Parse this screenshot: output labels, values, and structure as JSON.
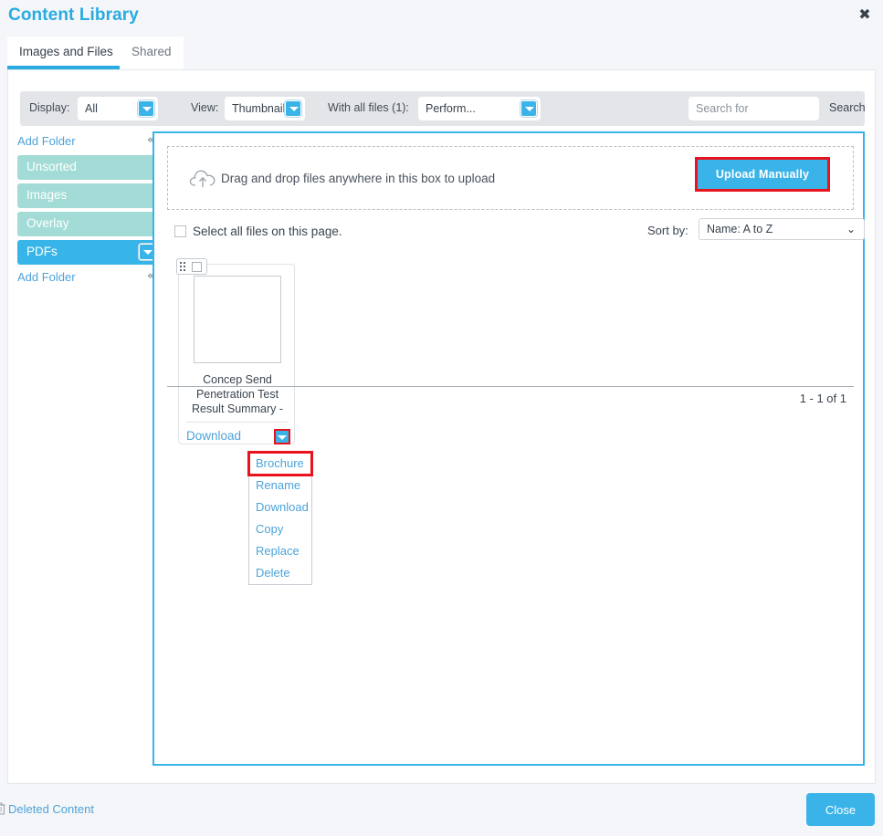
{
  "window": {
    "title": "Content Library",
    "close_icon": "close-x-icon"
  },
  "tabs": [
    {
      "label": "Images and Files",
      "active": true
    },
    {
      "label": "Shared",
      "active": false
    }
  ],
  "toolbar": {
    "display_label": "Display:",
    "display_value": "All",
    "view_label": "View:",
    "view_value": "Thumbnails",
    "files_label": "With all files (1):",
    "files_value": "Perform...",
    "search_placeholder": "Search for",
    "search_value": "",
    "search_button": "Search"
  },
  "sidebar": {
    "add_folder_top": "Add Folder",
    "add_folder_bottom": "Add Folder",
    "collapse_icon": "chevron-double-left-icon",
    "folders": [
      {
        "label": "Unsorted",
        "active": false
      },
      {
        "label": "Images",
        "active": false
      },
      {
        "label": "Overlay",
        "active": false
      },
      {
        "label": "PDFs",
        "active": true
      }
    ]
  },
  "content": {
    "dropzone_text": "Drag and drop files anywhere in this box to upload",
    "upload_button": "Upload Manually",
    "select_all_label": "Select all files on this page.",
    "sort_by_label": "Sort by:",
    "sort_by_value": "Name: A to Z",
    "pagination": "1 - 1 of 1"
  },
  "file_card": {
    "name": "Concep Send Penetration Test Result Summary -",
    "download_label": "Download",
    "dropdown_icon": "caret-down-icon"
  },
  "context_menu": {
    "items": [
      {
        "label": "Brochure",
        "highlighted": true
      },
      {
        "label": "Rename",
        "highlighted": false
      },
      {
        "label": "Download",
        "highlighted": false
      },
      {
        "label": "Copy",
        "highlighted": false
      },
      {
        "label": "Replace",
        "highlighted": false
      },
      {
        "label": "Delete",
        "highlighted": false
      }
    ]
  },
  "footer": {
    "deleted_content_label": "Deleted Content",
    "close_button": "Close"
  },
  "colors": {
    "accent": "#29abe2",
    "folder_active": "#37b5e8",
    "folder_idle": "#a3dcd6",
    "link": "#4da3d8",
    "highlight_red": "#e8131d"
  }
}
